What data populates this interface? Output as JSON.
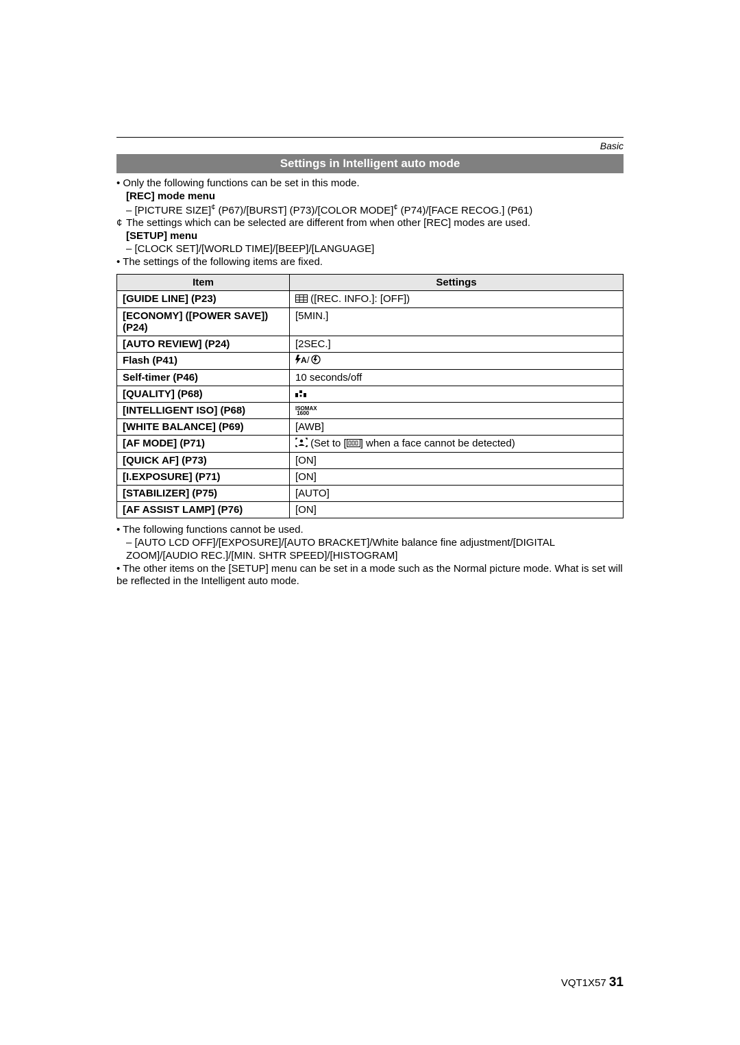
{
  "header": {
    "section_category": "Basic",
    "section_title": "Settings in Intelligent auto mode"
  },
  "intro": {
    "line1": "Only the following functions can be set in this mode.",
    "rec_menu_label": "[REC] mode menu",
    "rec_menu_items_prefix": "[PICTURE SIZE]",
    "rec_menu_items_mid1": " (P67)/[BURST] (P73)/[COLOR MODE]",
    "rec_menu_items_suffix": " (P74)/[FACE RECOG.] (P61)",
    "ref_note": "The settings which can be selected are different from when other [REC] modes are used.",
    "setup_menu_label": "[SETUP] menu",
    "setup_menu_items": "[CLOCK SET]/[WORLD TIME]/[BEEP]/[LANGUAGE]",
    "fixed_note": "The settings of the following items are fixed."
  },
  "table": {
    "head_item": "Item",
    "head_settings": "Settings",
    "rows": [
      {
        "item": "[GUIDE LINE] (P23)",
        "setting_text": " ([REC. INFO.]: [OFF])",
        "icon": "grid"
      },
      {
        "item": "[ECONOMY] ([POWER SAVE]) (P24)",
        "setting_text": "[5MIN.]",
        "icon": null
      },
      {
        "item": "[AUTO REVIEW] (P24)",
        "setting_text": "[2SEC.]",
        "icon": null
      },
      {
        "item": "Flash (P41)",
        "setting_text": "",
        "icon": "flash"
      },
      {
        "item": "Self-timer (P46)",
        "setting_text": "10 seconds/off",
        "icon": null
      },
      {
        "item": "[QUALITY] (P68)",
        "setting_text": "",
        "icon": "quality"
      },
      {
        "item": "[INTELLIGENT ISO] (P68)",
        "setting_text": "",
        "icon": "isomax"
      },
      {
        "item": "[WHITE BALANCE] (P69)",
        "setting_text": "[AWB]",
        "icon": null
      },
      {
        "item": "[AF MODE] (P71)",
        "setting_text_prefix": " (Set to [",
        "setting_text_suffix": "] when a face cannot be detected)",
        "icon": "afmode"
      },
      {
        "item": "[QUICK AF] (P73)",
        "setting_text": "[ON]",
        "icon": null
      },
      {
        "item": "[I.EXPOSURE] (P71)",
        "setting_text": "[ON]",
        "icon": null
      },
      {
        "item": "[STABILIZER] (P75)",
        "setting_text": "[AUTO]",
        "icon": null
      },
      {
        "item": "[AF ASSIST LAMP] (P76)",
        "setting_text": "[ON]",
        "icon": null
      }
    ]
  },
  "outro": {
    "line1": "The following functions cannot be used.",
    "dash1": "[AUTO LCD OFF]/[EXPOSURE]/[AUTO BRACKET]/White balance fine adjustment/[DIGITAL ZOOM]/[AUDIO REC.]/[MIN. SHTR SPEED]/[HISTOGRAM]",
    "line2": "The other items on the [SETUP] menu can be set in a mode such as the Normal picture mode. What is set will be reflected in the Intelligent auto mode."
  },
  "footer": {
    "doc_id": "VQT1X57",
    "page_num": "31"
  },
  "ref_symbol": "¢"
}
